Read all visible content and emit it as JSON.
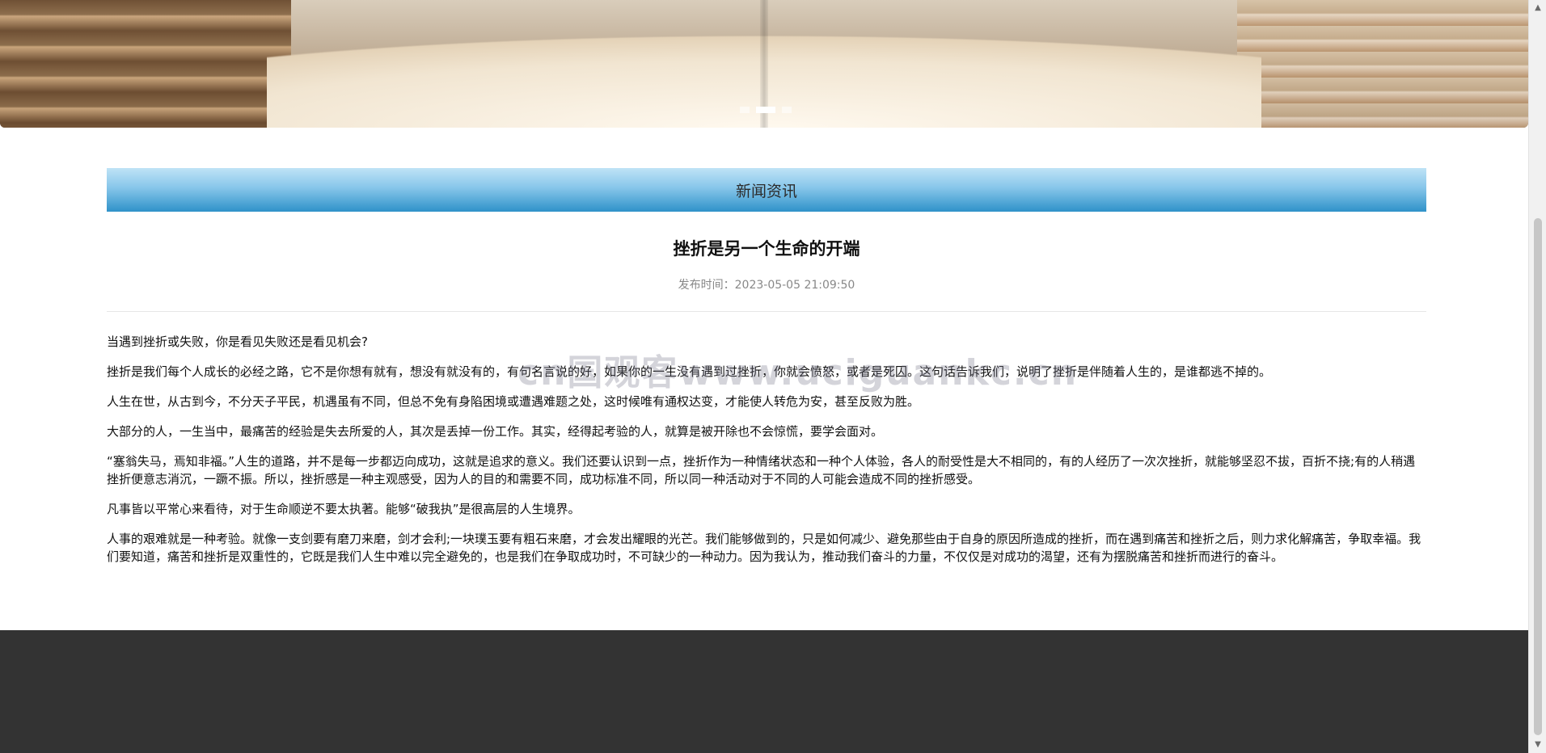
{
  "banner": {
    "slides_total": 3,
    "active_slide": 2
  },
  "section": {
    "title": "新闻资讯"
  },
  "article": {
    "title": "挫折是另一个生命的开端",
    "meta": "发布时间：2023-05-05 21:09:50",
    "paragraphs": [
      "当遇到挫折或失败，你是看见失败还是看见机会?",
      "挫折是我们每个人成长的必经之路，它不是你想有就有，想没有就没有的，有句名言说的好，如果你的一生没有遇到过挫折，你就会愤怒，或者是死囚。这句话告诉我们，说明了挫折是伴随着人生的，是谁都逃不掉的。",
      "人生在世，从古到今，不分天子平民，机遇虽有不同，但总不免有身陷困境或遭遇难题之处，这时候唯有通权达变，才能使人转危为安，甚至反败为胜。",
      "大部分的人，一生当中，最痛苦的经验是失去所爱的人，其次是丢掉一份工作。其实，经得起考验的人，就算是被开除也不会惊慌，要学会面对。",
      "“塞翁失马，焉知非福。”人生的道路，并不是每一步都迈向成功，这就是追求的意义。我们还要认识到一点，挫折作为一种情绪状态和一种个人体验，各人的耐受性是大不相同的，有的人经历了一次次挫折，就能够坚忍不拔，百折不挠;有的人稍遇挫折便意志消沉，一蹶不振。所以，挫折感是一种主观感受，因为人的目的和需要不同，成功标准不同，所以同一种活动对于不同的人可能会造成不同的挫折感受。",
      "凡事皆以平常心来看待，对于生命顺逆不要太执著。能够“破我执”是很高层的人生境界。",
      "人事的艰难就是一种考验。就像一支剑要有磨刀来磨，剑才会利;一块璞玉要有粗石来磨，才会发出耀眼的光芒。我们能够做到的，只是如何减少、避免那些由于自身的原因所造成的挫折，而在遇到痛苦和挫折之后，则力求化解痛苦，争取幸福。我们要知道，痛苦和挫折是双重性的，它既是我们人生中难以完全避免的，也是我们在争取成功时，不可缺少的一种动力。因为我认为，推动我们奋斗的力量，不仅仅是对成功的渴望，还有为摆脱痛苦和挫折而进行的奋斗。"
    ]
  },
  "watermark": {
    "text": "cn国观客www.uciguankc.cn"
  },
  "scrollbar": {
    "up_icon": "▲",
    "down_icon": "▼"
  }
}
